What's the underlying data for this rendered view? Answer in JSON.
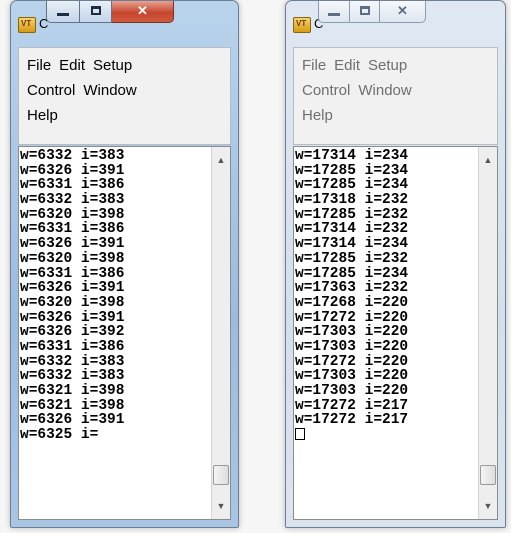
{
  "windows": [
    {
      "title": "C",
      "menu": {
        "rows": [
          [
            "File",
            "Edit",
            "Setup"
          ],
          [
            "Control",
            "Window"
          ],
          [
            "Help"
          ]
        ]
      },
      "console": {
        "lines": [
          "w=6332 i=383",
          "w=6326 i=391",
          "w=6331 i=386",
          "w=6332 i=383",
          "w=6320 i=398",
          "w=6331 i=386",
          "w=6326 i=391",
          "w=6320 i=398",
          "w=6331 i=386",
          "w=6326 i=391",
          "w=6320 i=398",
          "w=6326 i=391",
          "w=6326 i=392",
          "w=6331 i=386",
          "w=6332 i=383",
          "w=6332 i=383",
          "w=6321 i=398",
          "w=6321 i=398",
          "w=6326 i=391",
          "w=6325 i="
        ],
        "show_cursor": false
      }
    },
    {
      "title": "C",
      "menu": {
        "rows": [
          [
            "File",
            "Edit",
            "Setup"
          ],
          [
            "Control",
            "Window"
          ],
          [
            "Help"
          ]
        ]
      },
      "console": {
        "lines": [
          "w=17314 i=234",
          "w=17285 i=234",
          "w=17285 i=234",
          "w=17318 i=232",
          "w=17285 i=232",
          "w=17314 i=232",
          "w=17314 i=234",
          "w=17285 i=232",
          "w=17285 i=234",
          "w=17363 i=232",
          "w=17268 i=220",
          "w=17272 i=220",
          "w=17303 i=220",
          "w=17303 i=220",
          "w=17272 i=220",
          "w=17303 i=220",
          "w=17303 i=220",
          "w=17272 i=217",
          "w=17272 i=217",
          ""
        ],
        "show_cursor": true
      }
    }
  ],
  "icons": {
    "app_icon": "vt-app-icon",
    "minimize": "minimize-icon",
    "maximize": "maximize-icon",
    "close": "close-icon"
  }
}
